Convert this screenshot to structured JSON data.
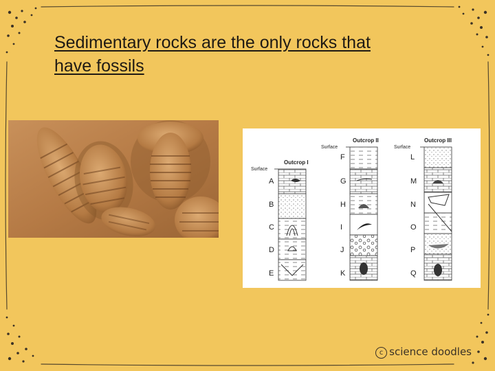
{
  "slide": {
    "title": "Sedimentary rocks are the only rocks that have fossils",
    "background_color": "#f2c65c"
  },
  "photo": {
    "subject": "trilobite fossils in rock",
    "icon": "trilobite-fossil-photo"
  },
  "diagram": {
    "surface_label": "Surface",
    "outcrops": [
      {
        "name": "Outcrop I",
        "layers": [
          "A",
          "B",
          "C",
          "D",
          "E"
        ]
      },
      {
        "name": "Outcrop II",
        "layers": [
          "F",
          "G",
          "H",
          "I",
          "J",
          "K"
        ]
      },
      {
        "name": "Outcrop III",
        "layers": [
          "L",
          "M",
          "N",
          "O",
          "P",
          "Q"
        ]
      }
    ]
  },
  "footer": {
    "copyright_symbol": "c",
    "credit": "science doodles"
  }
}
